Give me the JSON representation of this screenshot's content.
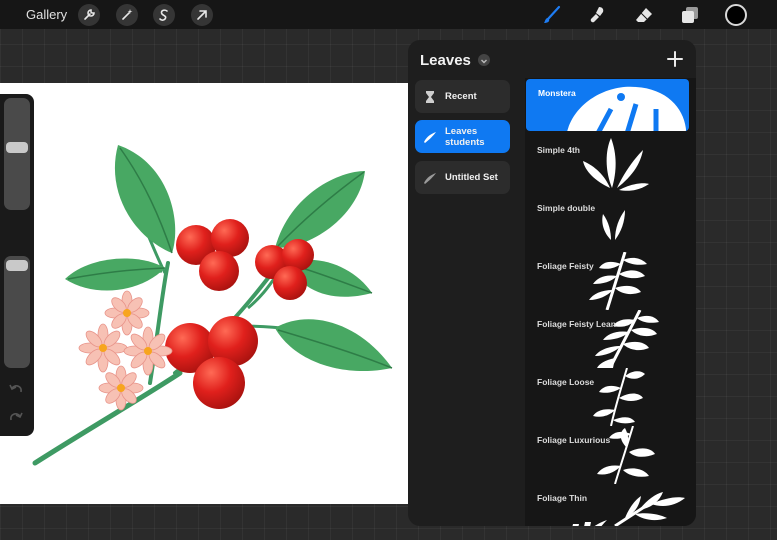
{
  "topbar": {
    "gallery_label": "Gallery",
    "left_tools": [
      "wrench-icon",
      "magic-wand-icon",
      "selection-icon",
      "transform-arrow-icon"
    ],
    "right_tools": [
      "brush-icon",
      "smudge-icon",
      "eraser-icon",
      "layers-icon"
    ],
    "current_color": "#000000",
    "active_tool_color": "#1e7cf2"
  },
  "brush_library": {
    "title": "Leaves",
    "sets": [
      {
        "label": "Recent",
        "icon": "hourglass-icon",
        "active": false
      },
      {
        "label": "Leaves students",
        "icon": "brush-stroke-icon",
        "active": true
      },
      {
        "label": "Untitled Set",
        "icon": "brush-stroke-icon",
        "active": false
      }
    ],
    "brushes": [
      {
        "name": "Monstera",
        "active": true
      },
      {
        "name": "Simple 4th",
        "active": false
      },
      {
        "name": "Simple double",
        "active": false
      },
      {
        "name": "Foliage Feisty",
        "active": false
      },
      {
        "name": "Foliage Feisty Lean",
        "active": false
      },
      {
        "name": "Foliage Loose",
        "active": false
      },
      {
        "name": "Foliage Luxurious",
        "active": false
      },
      {
        "name": "Foliage Thin",
        "active": false
      }
    ]
  },
  "colors": {
    "accent": "#0f79f2",
    "berry": "#e0201c",
    "leaf": "#3f9c5a",
    "flower": "#f7c1b4"
  }
}
